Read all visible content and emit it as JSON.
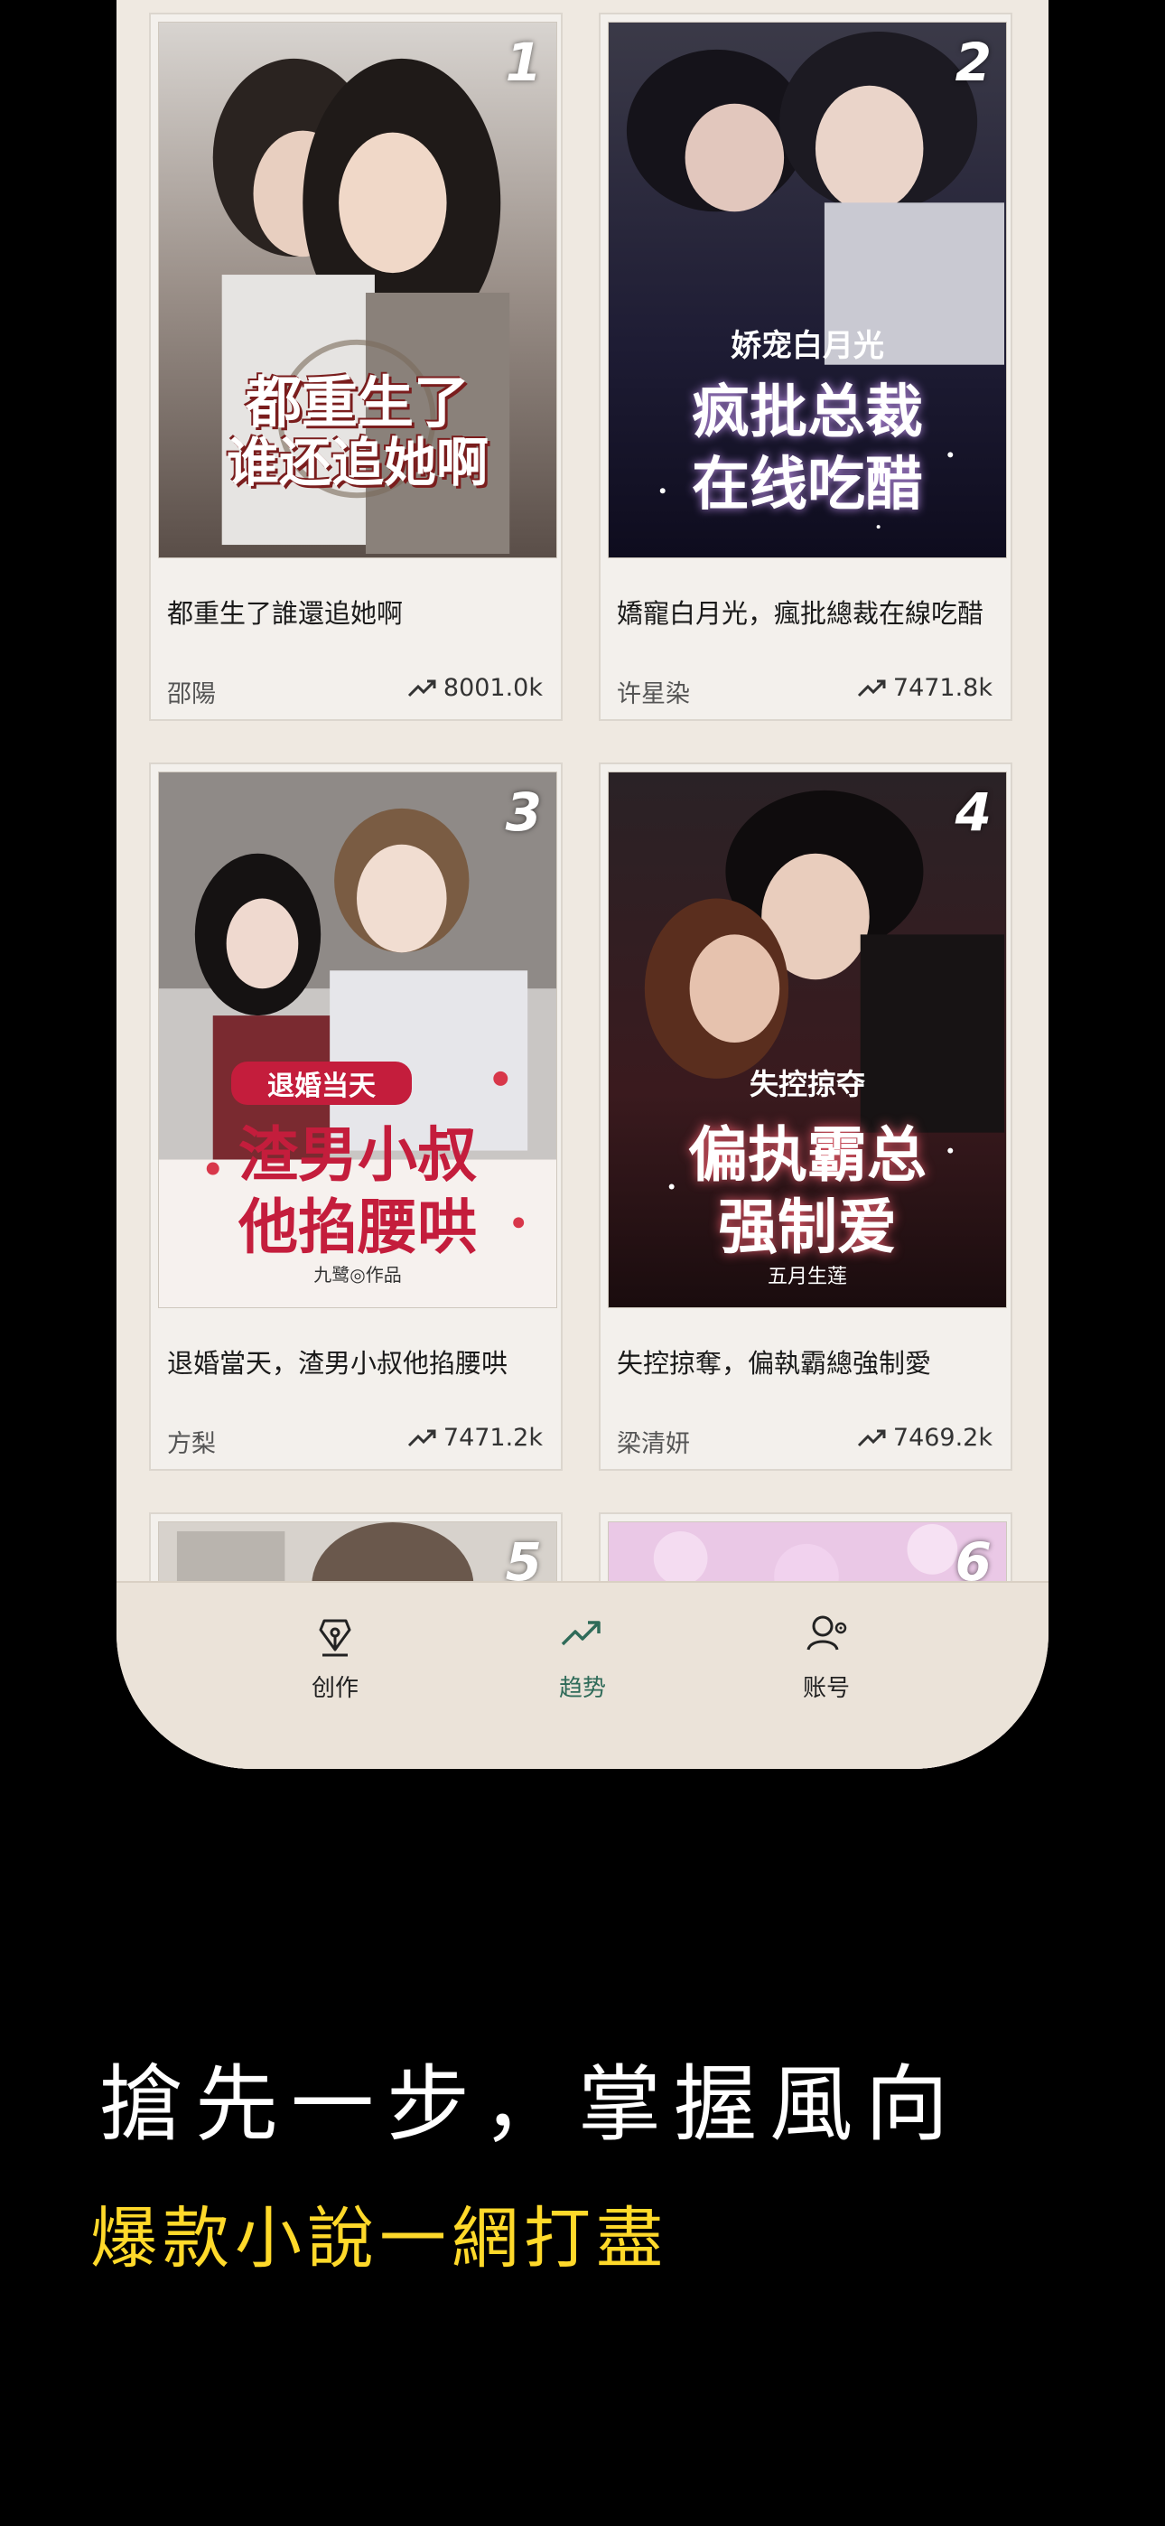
{
  "books": [
    {
      "rank": "1",
      "title": "都重生了誰還追她啊",
      "author": "邵陽",
      "views": "8001.0k",
      "cover_lines": [
        "都重生了",
        "谁还追她啊"
      ],
      "cover_sub": ""
    },
    {
      "rank": "2",
      "title": "嬌寵白月光，瘋批總裁在線吃醋",
      "author": "许星染",
      "views": "7471.8k",
      "cover_lines": [
        "疯批总裁",
        "在线吃醋"
      ],
      "cover_sub": "娇宠白月光"
    },
    {
      "rank": "3",
      "title": "退婚當天，渣男小叔他掐腰哄",
      "author": "方梨",
      "views": "7471.2k",
      "cover_lines": [
        "渣男小叔",
        "他掐腰哄"
      ],
      "cover_sub": "退婚当天",
      "cover_credit": "九鹭◎作品"
    },
    {
      "rank": "4",
      "title": "失控掠奪，偏執霸總強制愛",
      "author": "梁清妍",
      "views": "7469.2k",
      "cover_lines": [
        "偏执霸总",
        "强制爱"
      ],
      "cover_sub": "失控掠夺",
      "cover_credit": "五月生莲"
    },
    {
      "rank": "5",
      "title": "",
      "author": "",
      "views": "",
      "cover_lines": [
        "",
        ""
      ],
      "cover_sub": ""
    },
    {
      "rank": "6",
      "title": "",
      "author": "",
      "views": "",
      "cover_lines": [
        "",
        ""
      ],
      "cover_sub": ""
    }
  ],
  "tabbar": {
    "tabs": [
      {
        "label": "创作",
        "icon": "pen-nib-icon"
      },
      {
        "label": "趋势",
        "icon": "trending-up-icon",
        "active": true
      },
      {
        "label": "账号",
        "icon": "user-settings-icon"
      }
    ]
  },
  "promo": {
    "headline": "搶先一步，掌握風向",
    "subline": "爆款小說一網打盡"
  },
  "colors": {
    "active_tab": "#2f6b59",
    "subline": "#ffd92a"
  }
}
